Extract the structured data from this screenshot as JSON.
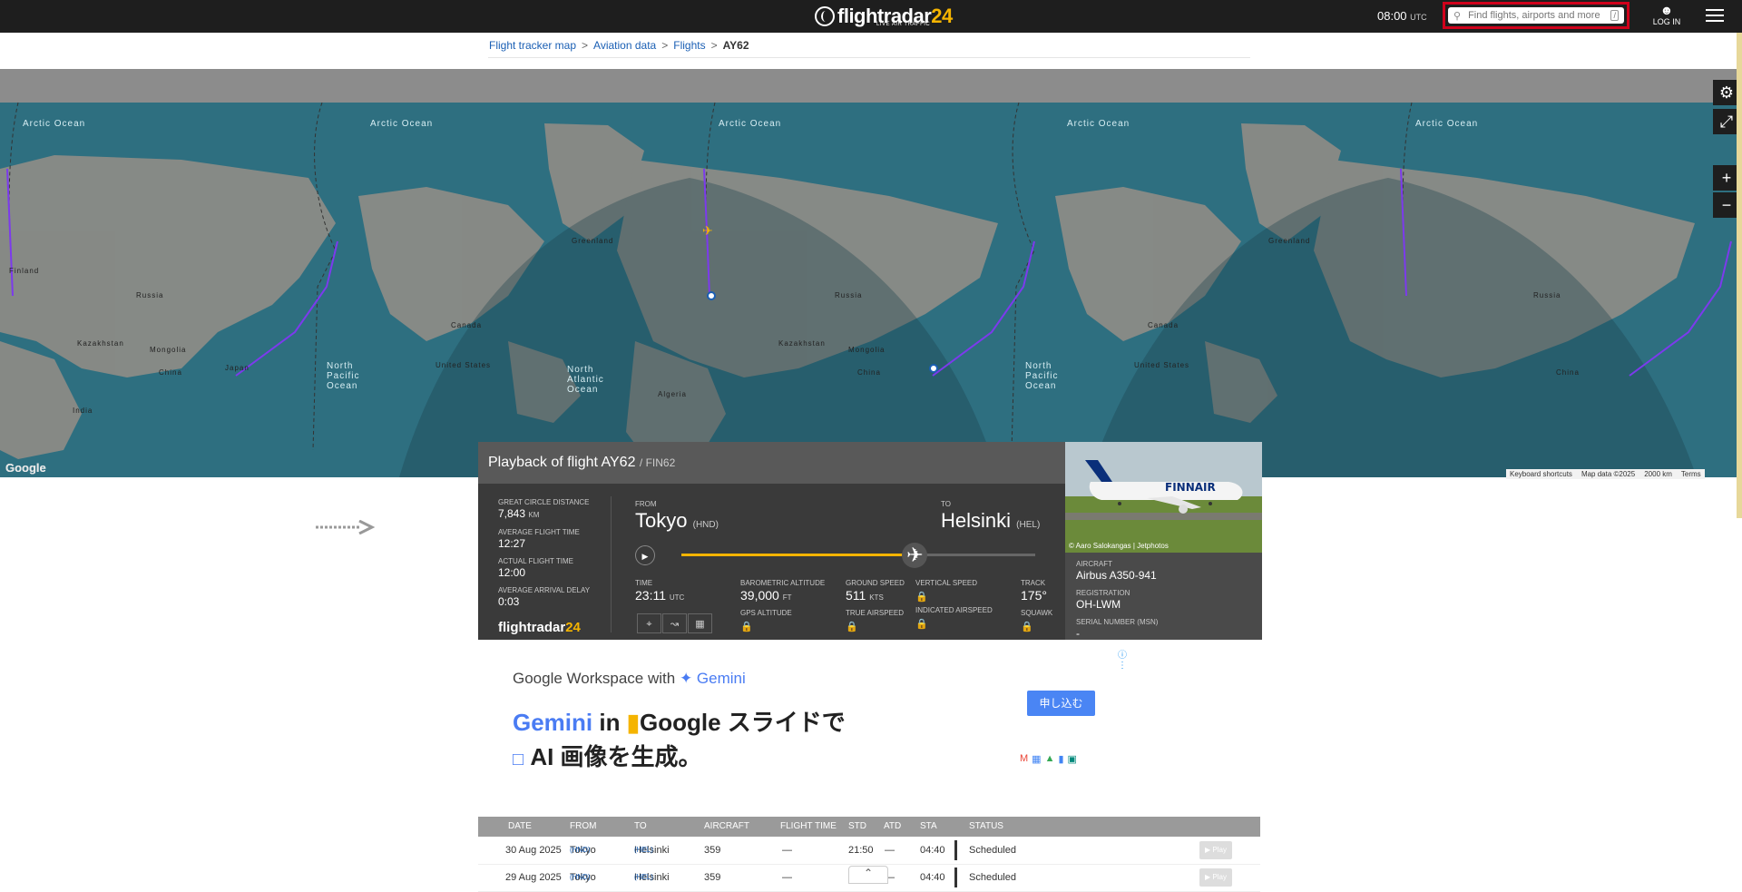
{
  "header": {
    "logo_text": "flightradar",
    "logo_num": "24",
    "logo_sub": "LIVE AIR TRAFFIC",
    "time": "08:00",
    "time_zone": "UTC",
    "search_placeholder": "Find flights, airports and more",
    "search_shortcut": "/",
    "login_label": "LOG IN"
  },
  "breadcrumb": {
    "items": [
      "Flight tracker map",
      "Aviation data",
      "Flights"
    ],
    "current": "AY62",
    "separator": ">"
  },
  "map": {
    "labels": {
      "arctic": "Arctic Ocean",
      "north_pacific_1": "North",
      "north_pacific_2": "Pacific",
      "north_pacific_3": "Ocean",
      "north_atlantic_1": "North",
      "north_atlantic_2": "Atlantic",
      "north_atlantic_3": "Ocean",
      "greenland": "Greenland",
      "russia": "Russia",
      "canada": "Canada",
      "china": "China",
      "mongolia": "Mongolia",
      "united_states": "United States",
      "kazakhstan": "Kazakhstan",
      "finland": "Finland",
      "japan": "Japan",
      "india": "India",
      "algeria": "Algeria"
    },
    "google": "Google",
    "attrib_shortcuts": "Keyboard shortcuts",
    "attrib_data": "Map data ©2025",
    "attrib_scale": "2000 km",
    "attrib_terms": "Terms",
    "colors": {
      "route": "#7c3aed",
      "ocean": "#2e6f80",
      "land": "#8b8b86"
    }
  },
  "map_controls": {
    "settings_icon": "⚙",
    "fullscreen_icon": "⤢",
    "zoom_in": "+",
    "zoom_out": "−"
  },
  "playback": {
    "title": "Playback of flight AY62",
    "callsign": "/ FIN62",
    "close": "✕",
    "great_circle_label": "GREAT CIRCLE DISTANCE",
    "great_circle_value": "7,843",
    "great_circle_unit": "KM",
    "avg_flight_label": "AVERAGE FLIGHT TIME",
    "avg_flight_value": "12:27",
    "actual_flight_label": "ACTUAL FLIGHT TIME",
    "actual_flight_value": "12:00",
    "avg_delay_label": "AVERAGE ARRIVAL DELAY",
    "avg_delay_value": "0:03",
    "from_label": "FROM",
    "from_city": "Tokyo",
    "from_code": "(HND)",
    "to_label": "TO",
    "to_city": "Helsinki",
    "to_code": "(HEL)",
    "progress_fraction": 0.66,
    "time_label": "TIME",
    "time_value": "23:11",
    "time_unit": "UTC",
    "baro_label": "BAROMETRIC ALTITUDE",
    "baro_value": "39,000",
    "baro_unit": "FT",
    "gps_label": "GPS ALTITUDE",
    "gs_label": "GROUND SPEED",
    "gs_value": "511",
    "gs_unit": "KTS",
    "tas_label": "TRUE AIRSPEED",
    "vs_label": "VERTICAL SPEED",
    "ias_label": "INDICATED AIRSPEED",
    "track_label": "TRACK",
    "track_value": "175°",
    "squawk_label": "SQUAWK",
    "lock_icon": "🔒",
    "logo_text": "flightradar",
    "logo_num": "24"
  },
  "aircraft": {
    "photo_credit": "© Aaro Salokangas | Jetphotos",
    "airline_livery": "FINNAIR",
    "type_label": "AIRCRAFT",
    "type_value": "Airbus A350-941",
    "reg_label": "REGISTRATION",
    "reg_value": "OH-LWM",
    "msn_label": "SERIAL NUMBER (MSN)",
    "msn_value": "-"
  },
  "ad": {
    "brand": "Google Workspace with",
    "brand_gemini": "✦ Gemini",
    "line1_a": "Gemini",
    "line1_b": " in ",
    "line1_c": "Google スライドで",
    "line2": "AI 画像を生成。",
    "cta": "申し込む",
    "info": "ⓘ ⋮"
  },
  "table": {
    "headers": [
      "DATE",
      "FROM",
      "TO",
      "AIRCRAFT",
      "FLIGHT TIME",
      "STD",
      "ATD",
      "STA",
      "STATUS"
    ],
    "rows": [
      {
        "date": "30 Aug 2025",
        "from": "Tokyo",
        "from_code": "(HND)",
        "to": "Helsinki",
        "to_code": "(HEL)",
        "aircraft": "359",
        "flight_time": "—",
        "std": "21:50",
        "atd": "—",
        "sta": "04:40",
        "status": "Scheduled",
        "play": "▶ Play"
      },
      {
        "date": "29 Aug 2025",
        "from": "Tokyo",
        "from_code": "(HND)",
        "to": "Helsinki",
        "to_code": "(HEL)",
        "aircraft": "359",
        "flight_time": "—",
        "std": "",
        "atd": "—",
        "sta": "04:40",
        "status": "Scheduled",
        "play": "▶ Play"
      }
    ]
  },
  "scroll_top": "⌃"
}
